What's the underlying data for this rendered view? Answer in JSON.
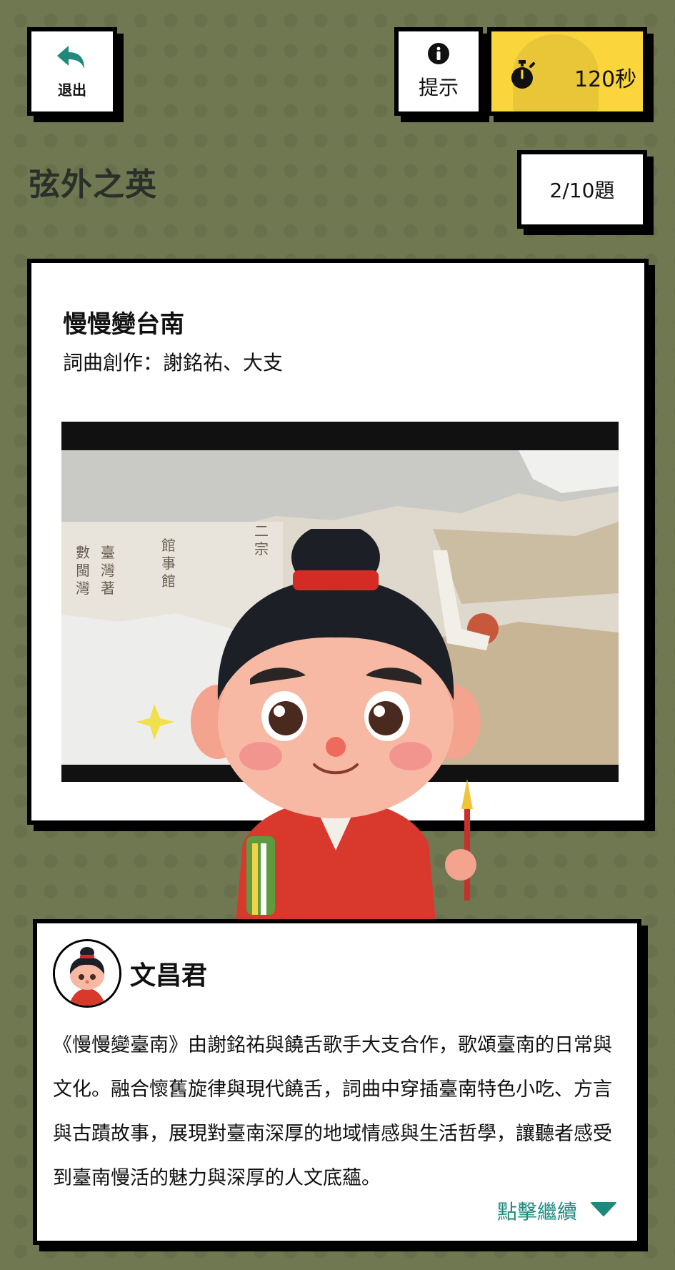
{
  "header": {
    "exit_label": "退出",
    "hint_label": "提示",
    "timer_text": "120秒",
    "counter_text": "2/10題"
  },
  "page": {
    "title": "弦外之英"
  },
  "song": {
    "title": "慢慢變台南",
    "credit": "詞曲創作：謝銘祐、大支"
  },
  "dialogue": {
    "speaker": "文昌君",
    "text": "《慢慢變臺南》由謝銘祐與饒舌歌手大支合作，歌頌臺南的日常與文化。融合懷舊旋律與現代饒舌，詞曲中穿插臺南特色小吃、方言與古蹟故事，展現對臺南深厚的地域情感與生活哲學，讓聽者感受到臺南慢活的魅力與深厚的人文底蘊。",
    "continue_label": "點擊繼續"
  },
  "icons": {
    "exit": "undo-arrow-icon",
    "hint": "info-circle-icon",
    "timer": "stopwatch-icon",
    "continue": "triangle-down-icon"
  },
  "colors": {
    "background": "#707852",
    "accent": "#1f8a7c",
    "timer": "#fbd53c"
  }
}
